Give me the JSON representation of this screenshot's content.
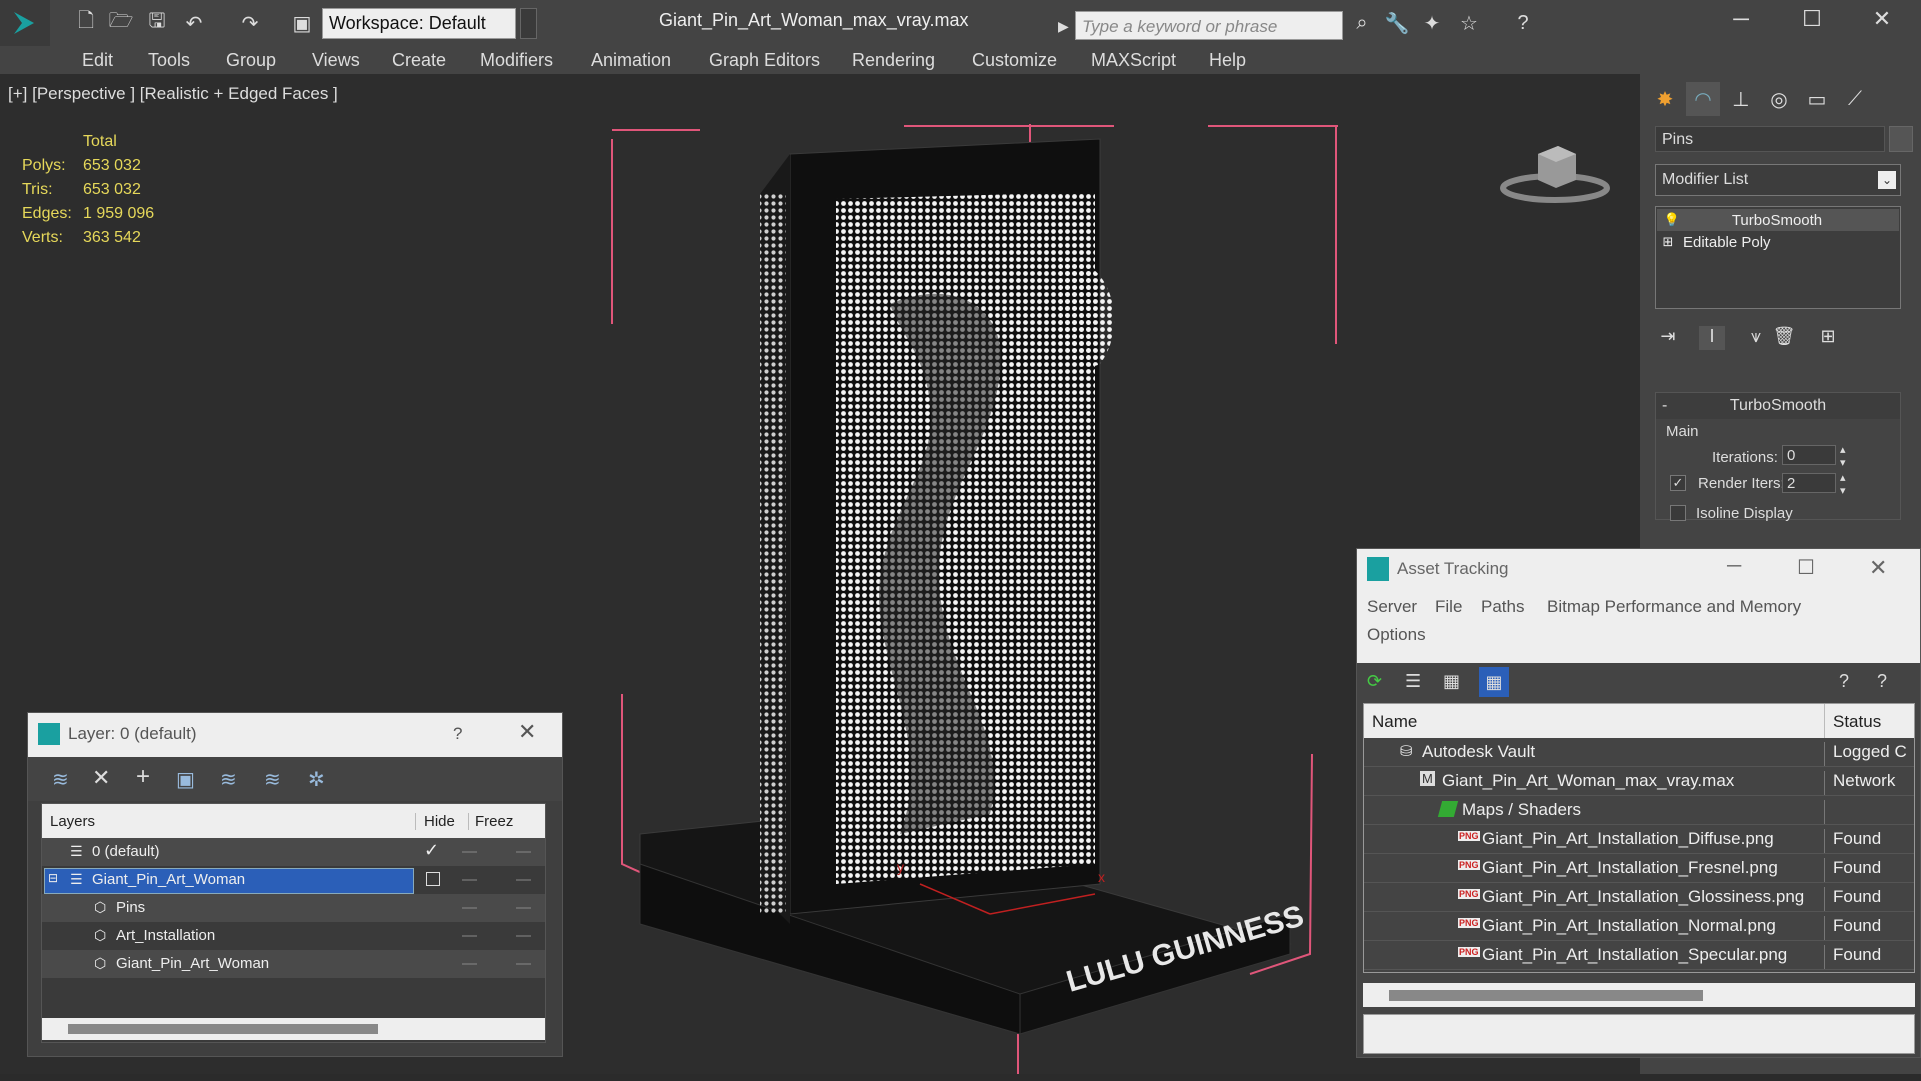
{
  "window": {
    "doc_title": "Giant_Pin_Art_Woman_max_vray.max",
    "workspace": "Workspace: Default",
    "search_placeholder": "Type a keyword or phrase"
  },
  "menu": [
    "Edit",
    "Tools",
    "Group",
    "Views",
    "Create",
    "Modifiers",
    "Animation",
    "Graph Editors",
    "Rendering",
    "Customize",
    "MAXScript",
    "Help"
  ],
  "viewport": {
    "label": "[+] [Perspective ] [Realistic + Edged Faces ]",
    "stats_header": "Total",
    "stats": [
      {
        "k": "Polys:",
        "v": "653 032"
      },
      {
        "k": "Tris:",
        "v": "653 032"
      },
      {
        "k": "Edges:",
        "v": "1 959 096"
      },
      {
        "k": "Verts:",
        "v": "363 542"
      }
    ],
    "base_text": "LULU GUINNESS",
    "axis_x": "x",
    "axis_y": "y"
  },
  "command_panel": {
    "object_name": "Pins",
    "modifier_list": "Modifier List",
    "stack": [
      "TurboSmooth",
      "Editable Poly"
    ],
    "rollout": {
      "title": "TurboSmooth",
      "group": "Main",
      "iterations_label": "Iterations:",
      "iterations_value": "0",
      "render_iters_label": "Render Iters:",
      "render_iters_value": "2",
      "isoline_label": "Isoline Display"
    }
  },
  "layer_dialog": {
    "title": "Layer: 0 (default)",
    "help": "?",
    "columns": {
      "layers": "Layers",
      "hide": "Hide",
      "freeze": "Freez"
    },
    "rows": [
      {
        "name": "0 (default)",
        "indent": 0
      },
      {
        "name": "Giant_Pin_Art_Woman",
        "indent": 0,
        "selected": true
      },
      {
        "name": "Pins",
        "indent": 1
      },
      {
        "name": "Art_Installation",
        "indent": 1
      },
      {
        "name": "Giant_Pin_Art_Woman",
        "indent": 1
      }
    ]
  },
  "asset_dialog": {
    "title": "Asset Tracking",
    "menu": [
      "Server",
      "File",
      "Paths",
      "Bitmap Performance and Memory",
      "Options"
    ],
    "columns": {
      "name": "Name",
      "status": "Status"
    },
    "rows": [
      {
        "name": "Autodesk Vault",
        "status": "Logged C",
        "indent": 0,
        "icon": "vault-icon"
      },
      {
        "name": "Giant_Pin_Art_Woman_max_vray.max",
        "status": "Network",
        "indent": 1,
        "icon": "max-file-icon"
      },
      {
        "name": "Maps / Shaders",
        "status": "",
        "indent": 2,
        "icon": "maps-icon"
      },
      {
        "name": "Giant_Pin_Art_Installation_Diffuse.png",
        "status": "Found",
        "indent": 3,
        "icon": "png-icon"
      },
      {
        "name": "Giant_Pin_Art_Installation_Fresnel.png",
        "status": "Found",
        "indent": 3,
        "icon": "png-icon"
      },
      {
        "name": "Giant_Pin_Art_Installation_Glossiness.png",
        "status": "Found",
        "indent": 3,
        "icon": "png-icon"
      },
      {
        "name": "Giant_Pin_Art_Installation_Normal.png",
        "status": "Found",
        "indent": 3,
        "icon": "png-icon"
      },
      {
        "name": "Giant_Pin_Art_Installation_Specular.png",
        "status": "Found",
        "indent": 3,
        "icon": "png-icon"
      }
    ]
  },
  "colors": {
    "accent": "#2b5fb8",
    "stats_yellow": "#e6d85a",
    "bbox_pink": "#e0567a"
  }
}
